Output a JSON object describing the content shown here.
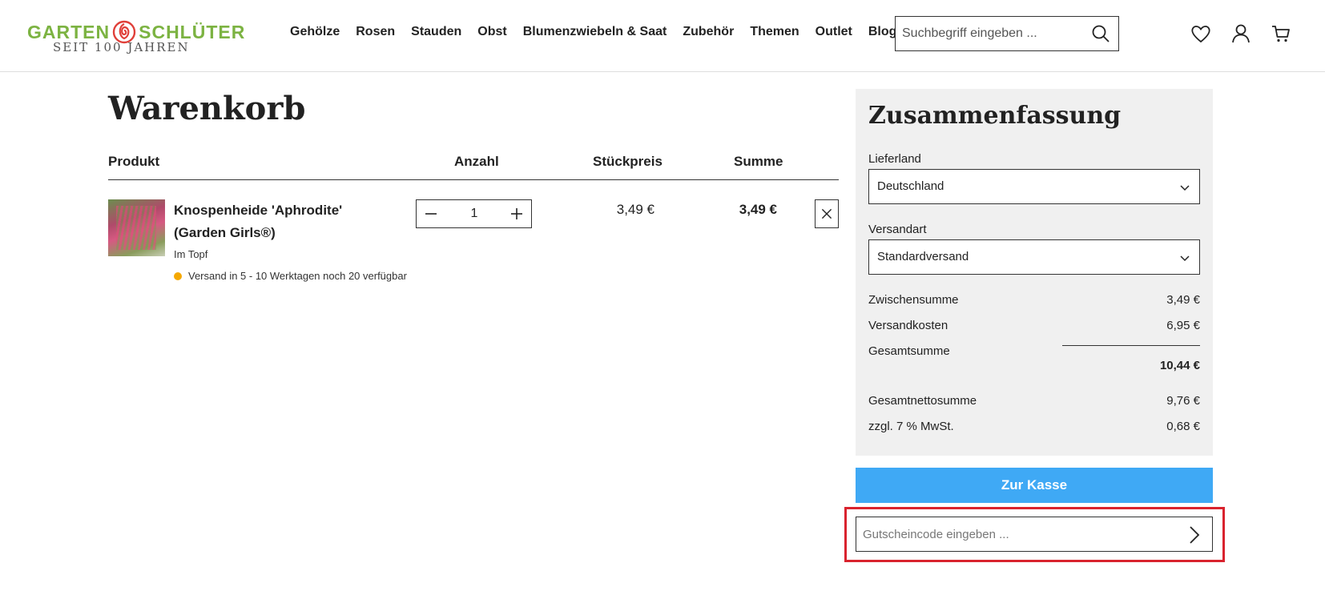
{
  "header": {
    "logo_brand_left": "GARTEN",
    "logo_brand_right": "SCHLÜTER",
    "logo_tagline": "SEIT 100 JAHREN",
    "brand_color": "#7cb342",
    "nav": [
      "Gehölze",
      "Rosen",
      "Stauden",
      "Obst",
      "Blumenzwiebeln & Saat",
      "Zubehör",
      "Themen",
      "Outlet",
      "Blog"
    ],
    "search": {
      "placeholder": "Suchbegriff eingeben ...",
      "icon": "search-icon"
    },
    "icons": [
      "heart-icon",
      "user-icon",
      "cart-icon"
    ]
  },
  "cart": {
    "title": "Warenkorb",
    "columns": {
      "product": "Produkt",
      "quantity": "Anzahl",
      "unit_price": "Stückpreis",
      "sum": "Summe"
    },
    "items": [
      {
        "name": "Knospenheide 'Aphrodite' (Garden Girls®)",
        "variant": "Im Topf",
        "stock_text": "Versand in 5 - 10 Werktagen noch 20 verfügbar",
        "stock_color": "#f5a800",
        "quantity": "1",
        "unit_price": "3,49 €",
        "sum": "3,49 €"
      }
    ]
  },
  "summary": {
    "title": "Zusammenfassung",
    "country_label": "Lieferland",
    "country_value": "Deutschland",
    "shipping_label": "Versandart",
    "shipping_value": "Standardversand",
    "subtotal_label": "Zwischensumme",
    "subtotal_value": "3,49 €",
    "shipping_cost_label": "Versandkosten",
    "shipping_cost_value": "6,95 €",
    "total_label": "Gesamtsumme",
    "total_value": "10,44 €",
    "net_label": "Gesamtnettosumme",
    "net_value": "9,76 €",
    "tax_label": "zzgl. 7 % MwSt.",
    "tax_value": "0,68 €",
    "checkout_label": "Zur Kasse",
    "checkout_color": "#3fa9f5",
    "voucher_placeholder": "Gutscheincode eingeben ...",
    "highlight_color": "#d9232e"
  }
}
